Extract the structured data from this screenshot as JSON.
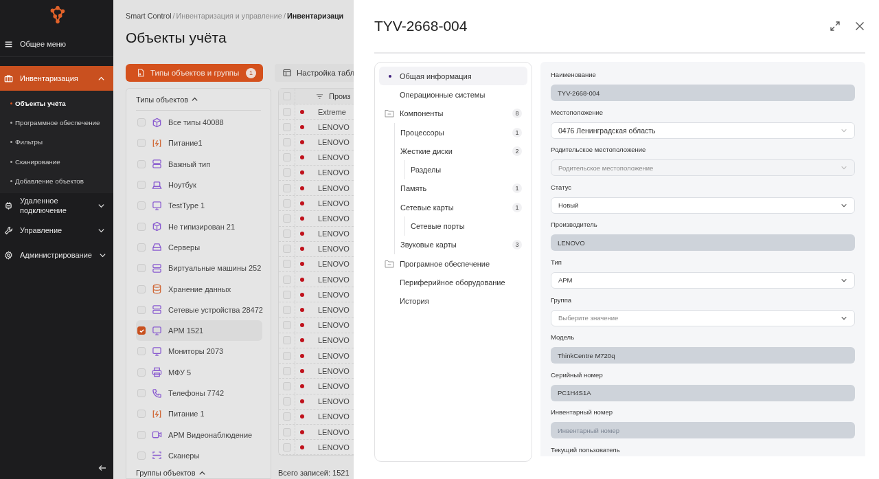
{
  "sidebar": {
    "items": [
      {
        "label": "Общее меню",
        "kind": "menu",
        "selected": false
      },
      {
        "label": "Инвентаризация",
        "kind": "briefcase",
        "selected": true,
        "expanded": true,
        "children": [
          {
            "label": "Объекты учёта",
            "selected": true
          },
          {
            "label": "Программное обеспечение",
            "selected": false
          },
          {
            "label": "Фильтры",
            "selected": false
          },
          {
            "label": "Сканирование",
            "selected": false
          },
          {
            "label": "Добавление объектов",
            "selected": false
          }
        ]
      },
      {
        "label": "Удаленное подключение",
        "kind": "plug",
        "selected": false,
        "expanded": false
      },
      {
        "label": "Управление",
        "kind": "wrench",
        "selected": false,
        "expanded": false
      },
      {
        "label": "Администрирование",
        "kind": "gear",
        "selected": false,
        "expanded": false
      }
    ]
  },
  "breadcrumb": {
    "separator": "/",
    "items": [
      "Smart Control",
      "Инвентаризация и управление",
      "Инвентаризаци"
    ]
  },
  "page_title": "Объекты учёта",
  "toolbar": {
    "types_button": {
      "label": "Типы объектов и группы",
      "badge": "1"
    },
    "table_settings_button": {
      "label": "Настройка табл"
    }
  },
  "types_panel": {
    "title": "Типы объектов",
    "items": [
      {
        "label": "Все типы 40088",
        "kind": "cube",
        "checked": false
      },
      {
        "label": "Питание1",
        "kind": "power",
        "checked": false
      },
      {
        "label": "Важный тип",
        "kind": "server",
        "checked": false
      },
      {
        "label": "Ноутбук",
        "kind": "laptop",
        "checked": false
      },
      {
        "label": "TestType 1",
        "kind": "monitor",
        "checked": false
      },
      {
        "label": "Не типизирован 21",
        "kind": "cube",
        "checked": false
      },
      {
        "label": "Серверы",
        "kind": "drive",
        "checked": false
      },
      {
        "label": "Виртуальные машины 252",
        "kind": "server",
        "checked": false
      },
      {
        "label": "Хранение данных",
        "kind": "database",
        "checked": false
      },
      {
        "label": "Сетевые устройства 28472",
        "kind": "server",
        "checked": false
      },
      {
        "label": "АРМ 1521",
        "kind": "monitor",
        "checked": true
      },
      {
        "label": "Мониторы 2073",
        "kind": "monitor",
        "checked": false
      },
      {
        "label": "МФУ 5",
        "kind": "printer",
        "checked": false
      },
      {
        "label": "Телефоны 7742",
        "kind": "phone",
        "checked": false
      },
      {
        "label": "Питание 1",
        "kind": "power",
        "checked": false
      },
      {
        "label": "АРМ Видеонаблюдение",
        "kind": "camera",
        "checked": false
      },
      {
        "label": "Сканеры",
        "kind": "scanner",
        "checked": false
      }
    ],
    "groups_title": "Группы объектов"
  },
  "table": {
    "columns": [
      "Произ"
    ],
    "all_checked": false,
    "rows": [
      {
        "manufacturer": "Extreme",
        "color": "#c0121c",
        "checked": false
      },
      {
        "manufacturer": "LENOVO",
        "color": "#c0121c",
        "checked": false
      },
      {
        "manufacturer": "LENOVO",
        "color": "#c0121c",
        "checked": false
      },
      {
        "manufacturer": "LENOVO",
        "color": "#c0121c",
        "checked": false
      },
      {
        "manufacturer": "LENOVO",
        "color": "#c0121c",
        "checked": false
      },
      {
        "manufacturer": "LENOVO",
        "color": "#c0121c",
        "checked": false
      },
      {
        "manufacturer": "LENOVO",
        "color": "#c0121c",
        "checked": false
      },
      {
        "manufacturer": "LENOVO",
        "color": "#c0121c",
        "checked": false
      },
      {
        "manufacturer": "LENOVO",
        "color": "#c0121c",
        "checked": false
      },
      {
        "manufacturer": "LENOVO",
        "color": "#c0121c",
        "checked": false
      },
      {
        "manufacturer": "LENOVO",
        "color": "#c0121c",
        "checked": false
      },
      {
        "manufacturer": "LENOVO",
        "color": "#c0121c",
        "checked": false
      },
      {
        "manufacturer": "LENOVO",
        "color": "#c0121c",
        "checked": false
      },
      {
        "manufacturer": "LENOVO",
        "color": "#c0121c",
        "checked": false
      },
      {
        "manufacturer": "LENOVO",
        "color": "#c0121c",
        "checked": false
      },
      {
        "manufacturer": "LENOVO",
        "color": "#c0121c",
        "checked": false
      },
      {
        "manufacturer": "LENOVO",
        "color": "#c0121c",
        "checked": false
      },
      {
        "manufacturer": "LENOVO",
        "color": "#c0121c",
        "checked": false
      },
      {
        "manufacturer": "LENOVO",
        "color": "#c0121c",
        "checked": false
      },
      {
        "manufacturer": "LENOVO",
        "color": "#c0121c",
        "checked": false
      },
      {
        "manufacturer": "LENOVO",
        "color": "#c0121c",
        "checked": false
      },
      {
        "manufacturer": "LENOVO",
        "color": "#c0121c",
        "checked": false
      },
      {
        "manufacturer": "LENOVO",
        "color": "#c0121c",
        "checked": false
      }
    ],
    "total": "Всего записей: 1521"
  },
  "drawer": {
    "title": "TYV-2668-004",
    "nav": [
      {
        "label": "Общая информация",
        "selected": true
      },
      {
        "label": "Операционные системы",
        "selected": false
      },
      {
        "label": "Компоненты",
        "kind": "folder",
        "count": "8",
        "selected": false,
        "children": [
          {
            "label": "Процессоры",
            "count": "1",
            "selected": false
          },
          {
            "label": "Жесткие диски",
            "count": "2",
            "selected": false,
            "children": [
              {
                "label": "Разделы",
                "selected": false
              }
            ]
          },
          {
            "label": "Память",
            "count": "1",
            "selected": false
          },
          {
            "label": "Сетевые карты",
            "count": "1",
            "selected": false,
            "children": [
              {
                "label": "Сетевые порты",
                "selected": false
              }
            ]
          },
          {
            "label": "Звуковые карты",
            "count": "3",
            "selected": false
          }
        ]
      },
      {
        "label": "Програмное обеспечение",
        "kind": "folder",
        "selected": false
      },
      {
        "label": "Периферийное оборудование",
        "selected": false
      },
      {
        "label": "История",
        "selected": false
      }
    ],
    "fields": [
      {
        "label": "Наименование",
        "kind": "readonly",
        "value": "TYV-2668-004"
      },
      {
        "label": "Местоположение",
        "kind": "select",
        "value": "0476 Ленинградская область",
        "disabled": false
      },
      {
        "label": "Родительское местоположение",
        "kind": "select",
        "placeholder": "Родительское местоположение",
        "disabled": true
      },
      {
        "label": "Статус",
        "kind": "select",
        "value": "Новый",
        "disabled": false
      },
      {
        "label": "Производитель",
        "kind": "readonly",
        "value": "LENOVO"
      },
      {
        "label": "Тип",
        "kind": "select",
        "value": "АРМ",
        "disabled": false
      },
      {
        "label": "Группа",
        "kind": "select",
        "placeholder": "Выберите значение",
        "disabled": false
      },
      {
        "label": "Модель",
        "kind": "readonly",
        "value": "ThinkCentre M720q"
      },
      {
        "label": "Серийный номер",
        "kind": "readonly",
        "value": "PC1H4S1A"
      },
      {
        "label": "Инвентарный номер",
        "kind": "readonly",
        "placeholder": "Инвентарный номер"
      },
      {
        "label": "Текущий пользователь"
      }
    ]
  }
}
